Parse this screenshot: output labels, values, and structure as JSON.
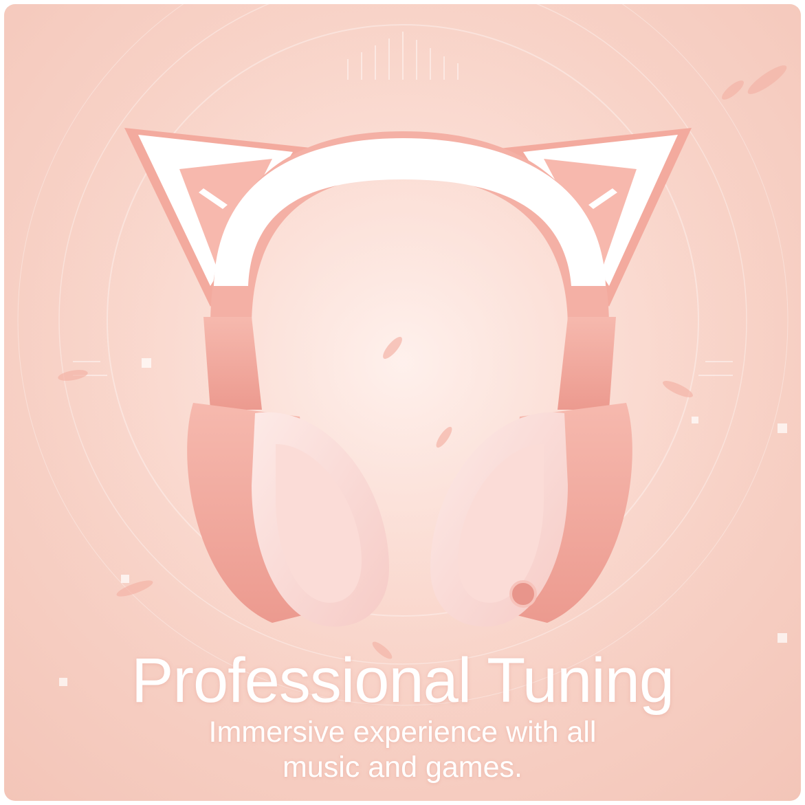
{
  "headline": "Professional Tuning",
  "subtitle": "Immersive experience with all music and games.",
  "colors": {
    "background": "#f8d3c8",
    "headset_pink": "#f0a89e",
    "headset_white": "#ffffff",
    "text": "#ffffff"
  },
  "icons": [
    "cat-ear-left-icon",
    "cat-ear-right-icon",
    "microphone-port-icon"
  ]
}
